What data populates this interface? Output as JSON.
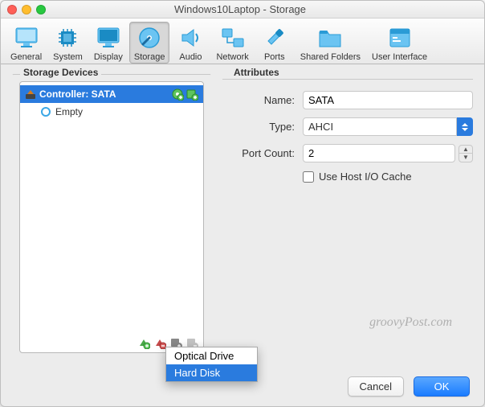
{
  "window": {
    "title": "Windows10Laptop - Storage"
  },
  "toolbar": [
    {
      "label": "General"
    },
    {
      "label": "System"
    },
    {
      "label": "Display"
    },
    {
      "label": "Storage"
    },
    {
      "label": "Audio"
    },
    {
      "label": "Network"
    },
    {
      "label": "Ports"
    },
    {
      "label": "Shared Folders"
    },
    {
      "label": "User Interface"
    }
  ],
  "storage_devices": {
    "title": "Storage Devices",
    "controller": "Controller: SATA",
    "empty": "Empty"
  },
  "popup": {
    "optical": "Optical Drive",
    "hard_disk": "Hard Disk"
  },
  "attributes": {
    "title": "Attributes",
    "name_label": "Name:",
    "name_value": "SATA",
    "type_label": "Type:",
    "type_value": "AHCI",
    "port_label": "Port Count:",
    "port_value": "2",
    "host_io": "Use Host I/O Cache"
  },
  "buttons": {
    "cancel": "Cancel",
    "ok": "OK"
  },
  "watermark": "groovyPost.com"
}
